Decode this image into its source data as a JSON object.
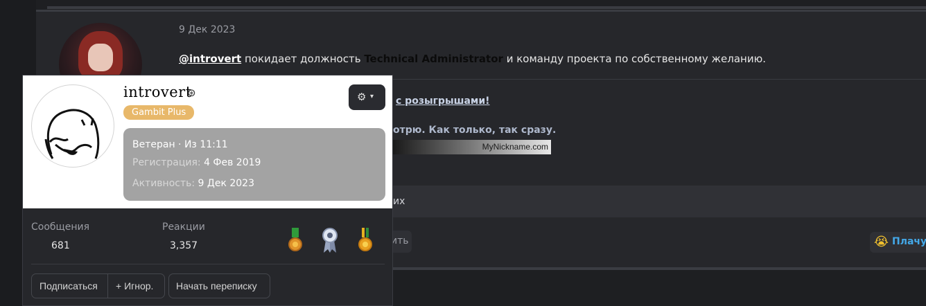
{
  "post": {
    "date": "9 Дек 2023",
    "mention": "@introvert",
    "text_before_role": " покидает должность ",
    "role": "Technical Administrator",
    "text_after_role": " и команду проекта по собственному желанию."
  },
  "signature": {
    "link_text": "с розыгрышами!",
    "line2": "отрю. Как только, так сразу.",
    "banner_text": "MyNickname.com"
  },
  "reactions": {
    "text": "их",
    "reply_label": "ить",
    "cry_emoji": "😭",
    "cry_label": "Плачу"
  },
  "tooltip": {
    "username": "introvert",
    "name_icon": "⊛",
    "badge": "Gambit Plus",
    "gear_icon": "⚙",
    "caret_icon": "▾",
    "info": {
      "title_line": "Ветеран · Из 11:11",
      "registration_label": "Регистрация:",
      "registration_value": "4 Фев 2019",
      "activity_label": "Активность:",
      "activity_value": "9 Дек 2023"
    },
    "stats": {
      "messages_label": "Сообщения",
      "messages_value": "681",
      "reactions_label": "Реакции",
      "reactions_value": "3,357"
    },
    "buttons": {
      "follow": "Подписаться",
      "ignore": "+ Игнор.",
      "message": "Начать переписку"
    }
  }
}
